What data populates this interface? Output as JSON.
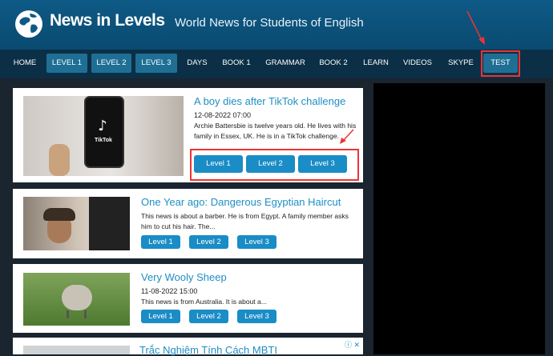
{
  "header": {
    "site_title": "News in Levels",
    "tagline": "World News for Students of English"
  },
  "nav": {
    "items": [
      "HOME",
      "LEVEL 1",
      "LEVEL 2",
      "LEVEL 3",
      "DAYS",
      "BOOK 1",
      "GRAMMAR",
      "BOOK 2",
      "LEARN",
      "VIDEOS",
      "SKYPE",
      "TEST"
    ]
  },
  "articles": [
    {
      "title": "A boy dies after TikTok challenge",
      "date": "12-08-2022 07:00",
      "excerpt": "Archie Battersbie is twelve years old. He lives with his family in Essex, UK. He is in a TikTok challenge.",
      "thumb_text": "TikTok",
      "levels": [
        "Level 1",
        "Level 2",
        "Level 3"
      ]
    },
    {
      "title": "One Year ago: Dangerous Egyptian Haircut",
      "excerpt": "This news is about a barber. He is from Egypt. A family member asks him to cut his hair. The...",
      "levels": [
        "Level 1",
        "Level 2",
        "Level 3"
      ]
    },
    {
      "title": "Very Wooly Sheep",
      "date": "11-08-2022 15:00",
      "excerpt": "This news is from Australia. It is about a...",
      "levels": [
        "Level 1",
        "Level 2",
        "Level 3"
      ]
    }
  ],
  "bottom_ad": {
    "title": "Trắc Nghiệm Tính Cách MBTI"
  },
  "colors": {
    "header": "#0e5a86",
    "nav": "#0b2f46",
    "level_button": "#1a8cc6",
    "title": "#1e8fc4",
    "annotation": "#e33333"
  }
}
